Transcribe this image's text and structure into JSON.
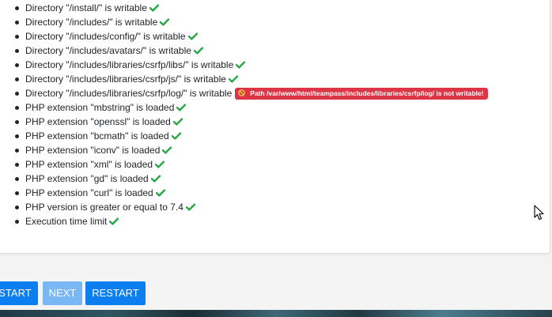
{
  "checks": [
    {
      "text": "Directory \"/install/\" is writable",
      "status": "ok"
    },
    {
      "text": "Directory \"/includes/\" is writable",
      "status": "ok"
    },
    {
      "text": "Directory \"/includes/config/\" is writable",
      "status": "ok"
    },
    {
      "text": "Directory \"/includes/avatars/\" is writable",
      "status": "ok"
    },
    {
      "text": "Directory \"/includes/libraries/csrfp/libs/\" is writable",
      "status": "ok"
    },
    {
      "text": "Directory \"/includes/libraries/csrfp/js/\" is writable",
      "status": "ok"
    },
    {
      "text": "Directory \"/includes/libraries/csrfp/log/\" is writable",
      "status": "error",
      "error": "Path /var/www/html/teampass/includes/libraries/csrfp/log/ is not writable!"
    },
    {
      "text": "PHP extension \"mbstring\" is loaded",
      "status": "ok"
    },
    {
      "text": "PHP extension \"openssl\" is loaded",
      "status": "ok"
    },
    {
      "text": "PHP extension \"bcmath\" is loaded",
      "status": "ok"
    },
    {
      "text": "PHP extension \"iconv\" is loaded",
      "status": "ok"
    },
    {
      "text": "PHP extension \"xml\" is loaded",
      "status": "ok"
    },
    {
      "text": "PHP extension \"gd\" is loaded",
      "status": "ok"
    },
    {
      "text": "PHP extension \"curl\" is loaded",
      "status": "ok"
    },
    {
      "text": "PHP version is greater or equal to 7.4",
      "status": "ok"
    },
    {
      "text": "Execution time limit",
      "status": "ok"
    }
  ],
  "icons": {
    "ok": "check-icon",
    "error": "ban-icon"
  },
  "colors": {
    "ok": "#28a745",
    "error": "#dc3545",
    "primary": "#0d7ef0",
    "primary_disabled": "#7ab7f5"
  },
  "buttons": {
    "start": "START",
    "next": "NEXT",
    "restart": "RESTART"
  }
}
